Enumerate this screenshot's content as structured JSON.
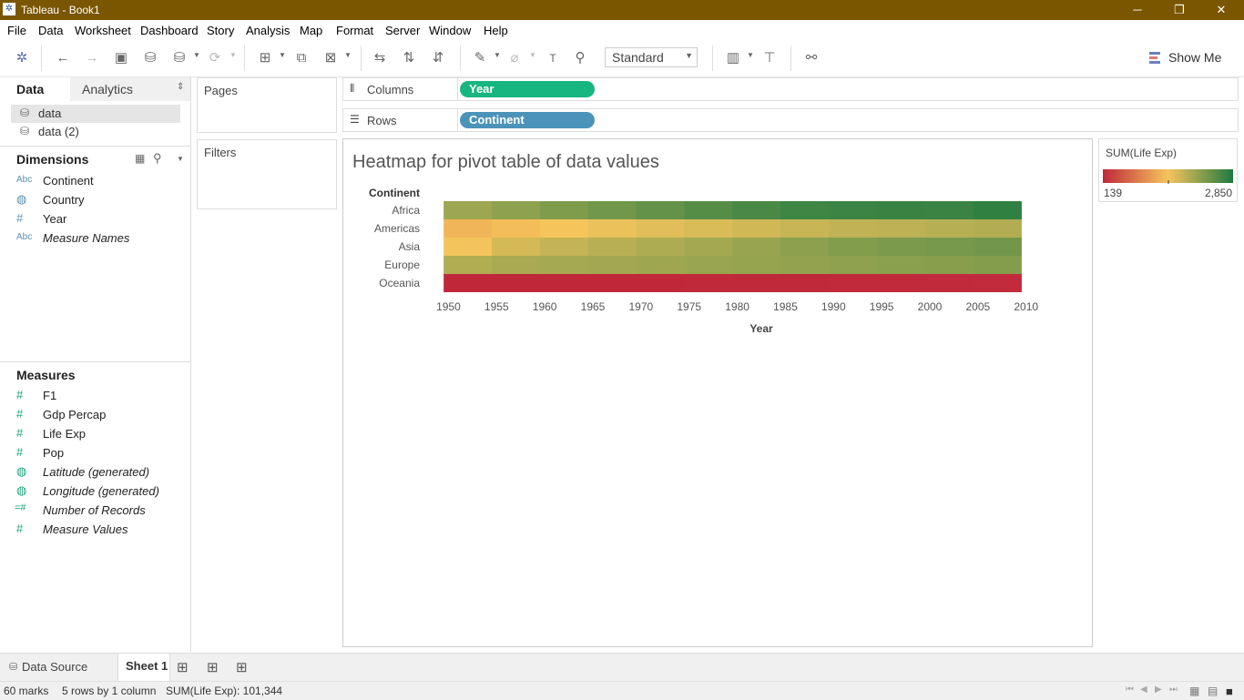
{
  "window": {
    "title": "Tableau - Book1",
    "minimize": "─",
    "restore": "❐",
    "close": "✕"
  },
  "menu": [
    "File",
    "Data",
    "Worksheet",
    "Dashboard",
    "Story",
    "Analysis",
    "Map",
    "Format",
    "Server",
    "Window",
    "Help"
  ],
  "toolbar": {
    "fit_mode": "Standard",
    "show_me": "Show Me"
  },
  "left_pane": {
    "tab_data": "Data",
    "tab_analytics": "Analytics",
    "sources": [
      "data",
      "data (2)"
    ],
    "dimensions_title": "Dimensions",
    "dimensions": [
      {
        "type": "Abc",
        "name": "Continent",
        "italic": false
      },
      {
        "type": "globe",
        "name": "Country",
        "italic": false
      },
      {
        "type": "#",
        "name": "Year",
        "italic": false
      },
      {
        "type": "Abc",
        "name": "Measure Names",
        "italic": true
      }
    ],
    "measures_title": "Measures",
    "measures": [
      {
        "type": "#",
        "name": "F1",
        "italic": false
      },
      {
        "type": "#",
        "name": "Gdp Percap",
        "italic": false
      },
      {
        "type": "#",
        "name": "Life Exp",
        "italic": false
      },
      {
        "type": "#",
        "name": "Pop",
        "italic": false
      },
      {
        "type": "globe",
        "name": "Latitude (generated)",
        "italic": true
      },
      {
        "type": "globe",
        "name": "Longitude (generated)",
        "italic": true
      },
      {
        "type": "=#",
        "name": "Number of Records",
        "italic": true
      },
      {
        "type": "#",
        "name": "Measure Values",
        "italic": true
      }
    ]
  },
  "cards": {
    "pages": "Pages",
    "filters": "Filters"
  },
  "shelves": {
    "columns_label": "Columns",
    "columns_pill": "Year",
    "rows_label": "Rows",
    "rows_pill": "Continent"
  },
  "view": {
    "title": "Heatmap for pivot table of data values"
  },
  "legend": {
    "title": "SUM(Life Exp)",
    "min_label": "139",
    "max_label": "2,850",
    "colors": [
      "#c0283a",
      "#f6c55c",
      "#1f7a3f"
    ]
  },
  "chart_data": {
    "type": "heatmap",
    "row_header": "Continent",
    "rows": [
      "Africa",
      "Americas",
      "Asia",
      "Europe",
      "Oceania"
    ],
    "x_tick_labels": [
      "1950",
      "1955",
      "1960",
      "1965",
      "1970",
      "1975",
      "1980",
      "1985",
      "1990",
      "1995",
      "2000",
      "2005",
      "2010"
    ],
    "x_columns": [
      1952,
      1957,
      1962,
      1967,
      1972,
      1977,
      1982,
      1987,
      1992,
      1997,
      2002,
      2007
    ],
    "xlabel": "Year",
    "value_range": [
      139,
      2850
    ],
    "values": [
      [
        2053,
        2148,
        2243,
        2330,
        2413,
        2502,
        2583,
        2650,
        2675,
        2690,
        2680,
        2747
      ],
      [
        1359,
        1426,
        1500,
        1563,
        1624,
        1678,
        1733,
        1790,
        1830,
        1860,
        1890,
        1925
      ],
      [
        1510,
        1705,
        1804,
        1888,
        1946,
        2009,
        2088,
        2160,
        2224,
        2267,
        2298,
        2325
      ],
      [
        1930,
        1978,
        2004,
        2024,
        2049,
        2075,
        2098,
        2119,
        2143,
        2166,
        2191,
        2211
      ],
      [
        139,
        141,
        143,
        143,
        143,
        146,
        149,
        150,
        153,
        156,
        159,
        161
      ]
    ]
  },
  "bottom": {
    "data_source": "Data Source",
    "sheet": "Sheet 1"
  },
  "status": {
    "marks": "60 marks",
    "dims": "5 rows by 1 column",
    "sum": "SUM(Life Exp): 101,344"
  }
}
